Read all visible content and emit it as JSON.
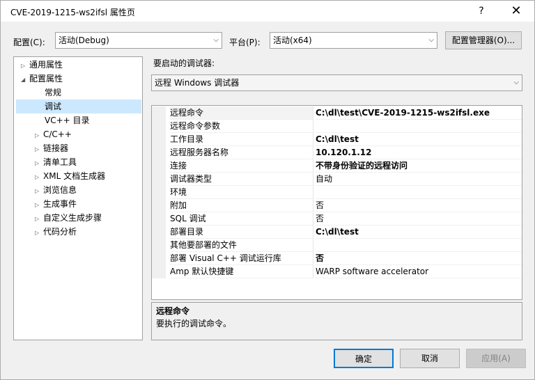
{
  "window": {
    "title": "CVE-2019-1215-ws2ifsl 属性页",
    "help_glyph": "?",
    "close_glyph": "✕"
  },
  "toolbar": {
    "config_label": "配置(C):",
    "config_value": "活动(Debug)",
    "platform_label": "平台(P):",
    "platform_value": "活动(x64)",
    "config_manager_label": "配置管理器(O)..."
  },
  "tree": {
    "items": [
      {
        "label": "通用属性",
        "expander": "▷"
      },
      {
        "label": "配置属性",
        "expander": "◢"
      },
      {
        "label": "常规",
        "expander": ""
      },
      {
        "label": "调试",
        "expander": ""
      },
      {
        "label": "VC++ 目录",
        "expander": ""
      },
      {
        "label": "C/C++",
        "expander": "▷"
      },
      {
        "label": "链接器",
        "expander": "▷"
      },
      {
        "label": "清单工具",
        "expander": "▷"
      },
      {
        "label": "XML 文档生成器",
        "expander": "▷"
      },
      {
        "label": "浏览信息",
        "expander": "▷"
      },
      {
        "label": "生成事件",
        "expander": "▷"
      },
      {
        "label": "自定义生成步骤",
        "expander": "▷"
      },
      {
        "label": "代码分析",
        "expander": "▷"
      }
    ]
  },
  "debugger": {
    "label": "要启动的调试器:",
    "value": "远程 Windows 调试器"
  },
  "properties": [
    {
      "name": "远程命令",
      "value": "C:\\dl\\test\\CVE-2019-1215-ws2ifsl.exe"
    },
    {
      "name": "远程命令参数",
      "value": ""
    },
    {
      "name": "工作目录",
      "value": "C:\\dl\\test"
    },
    {
      "name": "远程服务器名称",
      "value": "10.120.1.12"
    },
    {
      "name": "连接",
      "value": "不带身份验证的远程访问"
    },
    {
      "name": "调试器类型",
      "value": "自动"
    },
    {
      "name": "环境",
      "value": ""
    },
    {
      "name": "附加",
      "value": "否"
    },
    {
      "name": "SQL 调试",
      "value": "否"
    },
    {
      "name": "部署目录",
      "value": "C:\\dl\\test"
    },
    {
      "name": "其他要部署的文件",
      "value": ""
    },
    {
      "name": "部署 Visual C++ 调试运行库",
      "value": "否"
    },
    {
      "name": "Amp 默认快捷键",
      "value": "WARP software accelerator"
    }
  ],
  "description": {
    "title": "远程命令",
    "text": "要执行的调试命令。"
  },
  "buttons": {
    "ok": "确定",
    "cancel": "取消",
    "apply": "应用(A)"
  }
}
